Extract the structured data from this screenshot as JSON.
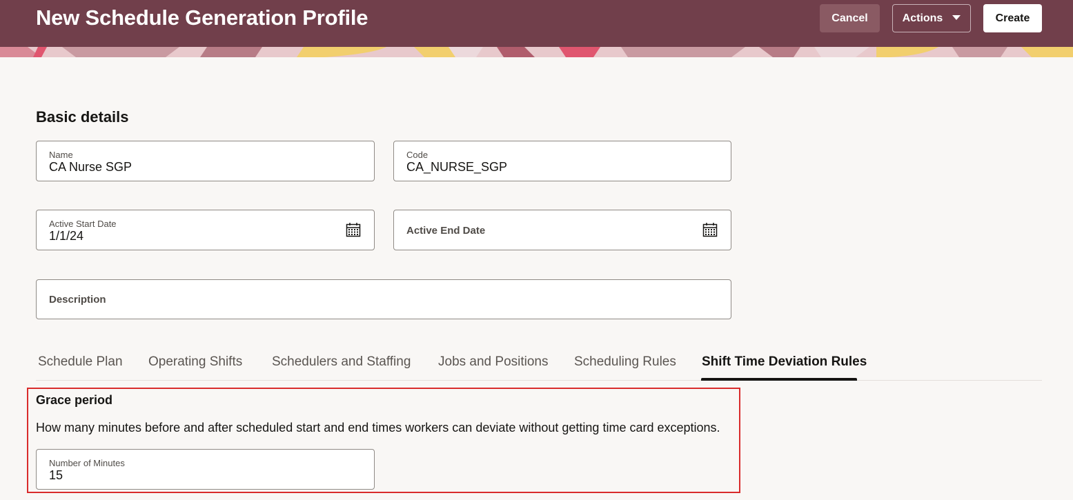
{
  "header": {
    "title": "New Schedule Generation Profile",
    "cancel_label": "Cancel",
    "actions_label": "Actions",
    "create_label": "Create",
    "background_color": "#713f4b"
  },
  "basic_details": {
    "title": "Basic details",
    "name": {
      "label": "Name",
      "value": "CA Nurse SGP"
    },
    "code": {
      "label": "Code",
      "value": "CA_NURSE_SGP"
    },
    "active_start_date": {
      "label": "Active Start Date",
      "value": "1/1/24",
      "icon": "calendar-icon"
    },
    "active_end_date": {
      "label": "Active End Date",
      "value": "",
      "icon": "calendar-icon"
    },
    "description": {
      "label": "Description",
      "value": ""
    }
  },
  "tabs": [
    {
      "label": "Schedule Plan",
      "active": false
    },
    {
      "label": "Operating Shifts",
      "active": false
    },
    {
      "label": "Schedulers and Staffing",
      "active": false
    },
    {
      "label": "Jobs and Positions",
      "active": false
    },
    {
      "label": "Scheduling Rules",
      "active": false
    },
    {
      "label": "Shift Time Deviation Rules",
      "active": true
    }
  ],
  "grace_period": {
    "title": "Grace period",
    "description": "How many minutes before and after scheduled start and end times workers can deviate without getting time card exceptions.",
    "minutes": {
      "label": "Number of Minutes",
      "value": "15"
    },
    "highlight_color": "#d92b2b"
  }
}
